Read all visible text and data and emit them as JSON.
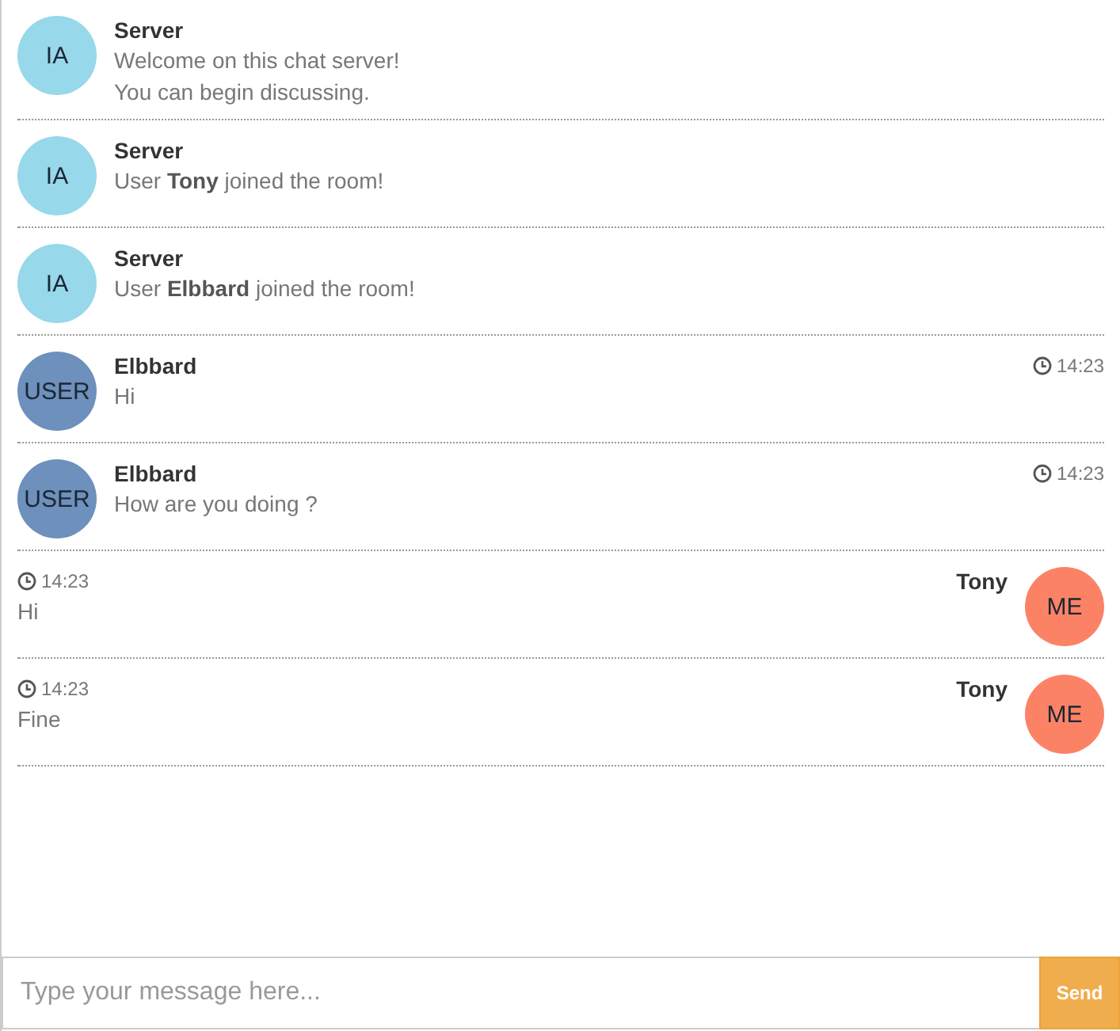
{
  "messages": [
    {
      "kind": "other",
      "avatar": "IA",
      "color": "#97d8ea",
      "author": "Server",
      "lines": [
        "Welcome on this chat server!",
        "You can begin discussing."
      ]
    },
    {
      "kind": "other",
      "avatar": "IA",
      "color": "#97d8ea",
      "author": "Server",
      "lines": [
        "User **Tony** joined the room!"
      ]
    },
    {
      "kind": "other",
      "avatar": "IA",
      "color": "#97d8ea",
      "author": "Server",
      "lines": [
        "User **Elbbard** joined the room!"
      ]
    },
    {
      "kind": "other",
      "avatar": "USER",
      "color": "#6d90bd",
      "author": "Elbbard",
      "time": "14:23",
      "lines": [
        "Hi"
      ]
    },
    {
      "kind": "other",
      "avatar": "USER",
      "color": "#6d90bd",
      "author": "Elbbard",
      "time": "14:23",
      "lines": [
        "How are you doing ?"
      ]
    },
    {
      "kind": "self",
      "avatar": "ME",
      "color": "#fc8266",
      "author": "Tony",
      "time": "14:23",
      "lines": [
        "Hi"
      ]
    },
    {
      "kind": "self",
      "avatar": "ME",
      "color": "#fc8266",
      "author": "Tony",
      "time": "14:23",
      "lines": [
        "Fine"
      ]
    }
  ],
  "composer": {
    "placeholder": "Type your message here...",
    "button": "Send"
  }
}
